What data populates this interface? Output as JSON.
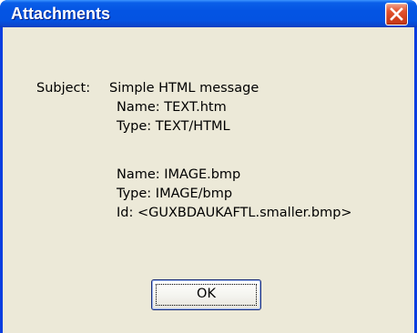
{
  "window": {
    "title": "Attachments",
    "close_icon": "close-icon"
  },
  "message": {
    "subject_label": "Subject:",
    "subject_value": "Simple HTML message",
    "attachments": [
      {
        "name_line": "Name: TEXT.htm",
        "type_line": "Type: TEXT/HTML"
      },
      {
        "name_line": "Name: IMAGE.bmp",
        "type_line": "Type: IMAGE/bmp",
        "id_line": "Id: <GUXBDAUKAFTL.smaller.bmp>"
      }
    ]
  },
  "buttons": {
    "ok_label": "OK"
  },
  "colors": {
    "titlebar_blue": "#0454e3",
    "client_background": "#ece9d8",
    "close_red": "#e3542f"
  }
}
